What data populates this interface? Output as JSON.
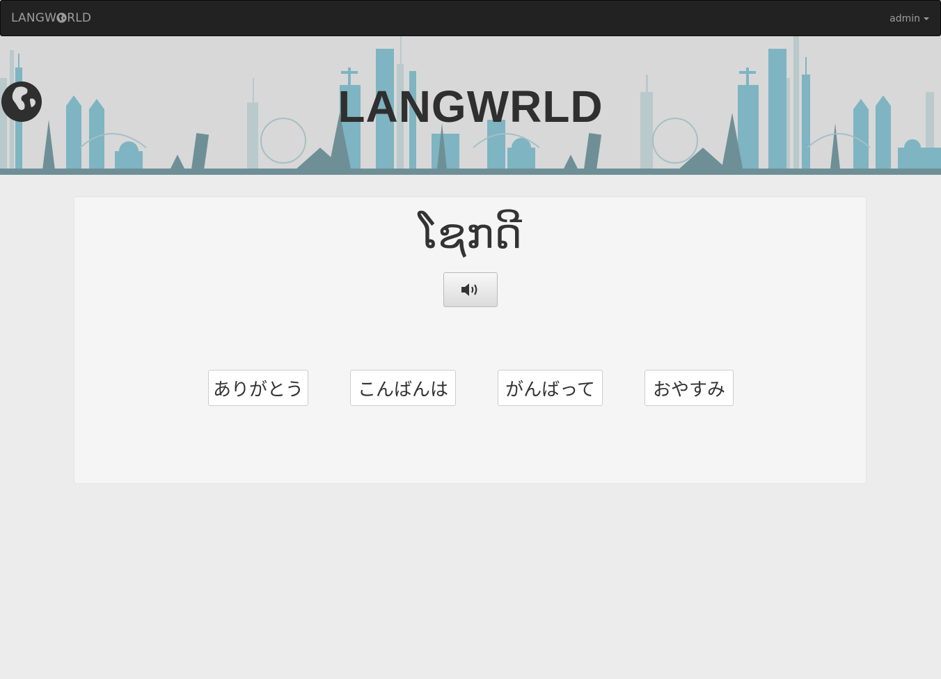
{
  "navbar": {
    "brand_pre": "LANGW",
    "brand_post": "RLD",
    "user_label": "admin"
  },
  "banner": {
    "title_pre": "LANGW",
    "title_post": "RLD"
  },
  "quiz": {
    "prompt_word": "ໂຊກດີ",
    "answers": [
      "ありがとう",
      "こんばんは",
      "がんばって",
      "おやすみ"
    ]
  },
  "icons": {
    "play": "speaker-icon",
    "logo_globe": "globe-icon",
    "user_caret": "caret-down-icon"
  },
  "colors": {
    "navbar_bg": "#222222",
    "banner_bg": "#d8d8d8",
    "skyline_teal": "#7fb4c2",
    "skyline_grey": "#6f8f96",
    "page_bg": "#ececec",
    "panel_bg": "#f5f5f5"
  }
}
